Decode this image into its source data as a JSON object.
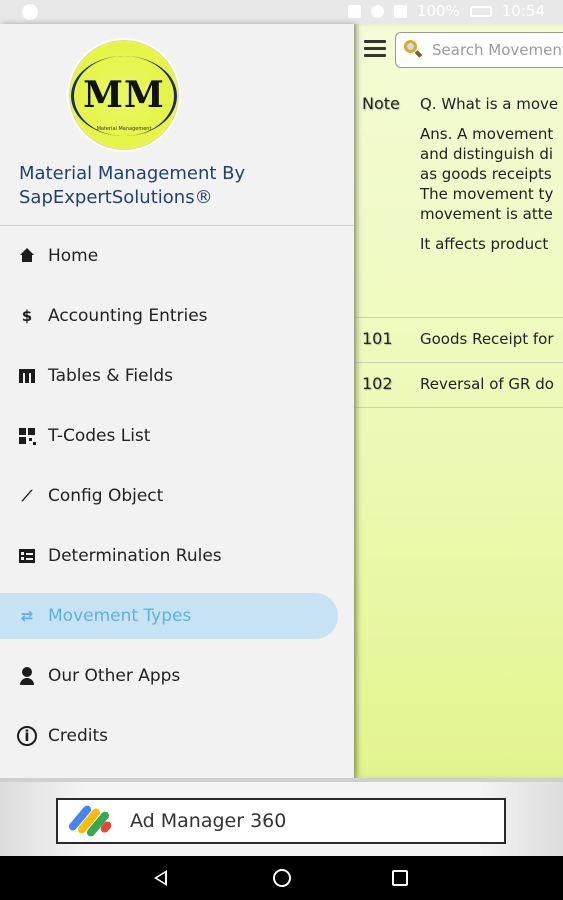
{
  "status_bar": {
    "battery": "100%",
    "time": "10:54"
  },
  "main": {
    "search": {
      "placeholder": "Search Movement"
    },
    "rows": [
      {
        "code": "Note",
        "lines": [
          "Q. What is a move",
          "Ans. A movement",
          "and distinguish di",
          "as goods receipts",
          "The movement ty",
          "movement is atte",
          "It affects product"
        ]
      },
      {
        "code": "101",
        "text": "Goods Receipt for"
      },
      {
        "code": "102",
        "text": "Reversal of GR do"
      }
    ]
  },
  "drawer": {
    "logo": {
      "letters": "MM",
      "tagline": "Material Management"
    },
    "app_title": "Material Management By SapExpertSolutions®",
    "items": [
      {
        "label": "Home",
        "icon": "home-icon"
      },
      {
        "label": "Accounting Entries",
        "icon": "dollar-icon",
        "glyph": "$"
      },
      {
        "label": "Tables & Fields",
        "icon": "table-icon"
      },
      {
        "label": "T-Codes List",
        "icon": "qr-code-icon"
      },
      {
        "label": "Config Object",
        "icon": "trending-icon",
        "glyph": "⟋"
      },
      {
        "label": "Determination Rules",
        "icon": "rules-icon"
      },
      {
        "label": "Movement Types",
        "icon": "swap-arrows-icon",
        "glyph": "⇄",
        "active": true
      },
      {
        "label": "Our Other Apps",
        "icon": "person-icon"
      },
      {
        "label": "Credits",
        "icon": "info-icon",
        "glyph": "i"
      }
    ],
    "active_color": "#5eb2e1",
    "active_bg": "#c7e2f2"
  },
  "ad": {
    "label": "Ad Manager 360"
  }
}
